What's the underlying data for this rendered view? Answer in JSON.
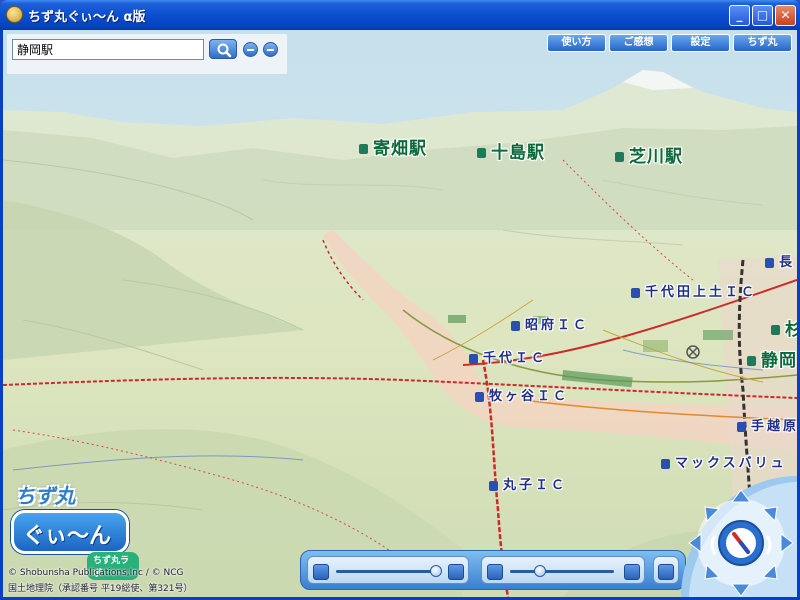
{
  "window": {
    "title": "ちず丸ぐぃ〜ん α版",
    "minimize_label": "_",
    "maximize_label": "□",
    "close_label": "✕"
  },
  "search": {
    "value": "静岡駅",
    "button_icon": "search-icon"
  },
  "toolbar": {
    "buttons": [
      {
        "label": "使い方"
      },
      {
        "label": "ご感想"
      },
      {
        "label": "設定"
      },
      {
        "label": "ちず丸"
      }
    ]
  },
  "map": {
    "station_labels": [
      {
        "text": "寄畑駅"
      },
      {
        "text": "十島駅"
      },
      {
        "text": "芝川駅"
      },
      {
        "text": "静岡"
      }
    ],
    "place_labels": [
      {
        "text": "千代田上土ＩＣ"
      },
      {
        "text": "昭府ＩＣ"
      },
      {
        "text": "千代ＩＣ"
      },
      {
        "text": "牧ヶ谷ＩＣ"
      },
      {
        "text": "手越原"
      },
      {
        "text": "丸子ＩＣ"
      },
      {
        "text": "マックスバリュ"
      },
      {
        "text": "長"
      },
      {
        "text": "杉"
      }
    ]
  },
  "logo": {
    "line1": "ちず丸",
    "line2": "ぐぃ〜ん",
    "badge": "ちず丸ラボ"
  },
  "copyright": {
    "line1": "© Shobunsha Publications,Inc / © NCG",
    "line2": "国土地理院（承認番号 平19総使、第321号）"
  },
  "navbar": {
    "tilt_value": 0.92,
    "zoom_value": 0.25
  },
  "colors": {
    "titlebar": "#0a4fd0",
    "accent_button": "#2665c9",
    "station_label": "#0c6a3a",
    "place_label": "#1f2e8a"
  }
}
